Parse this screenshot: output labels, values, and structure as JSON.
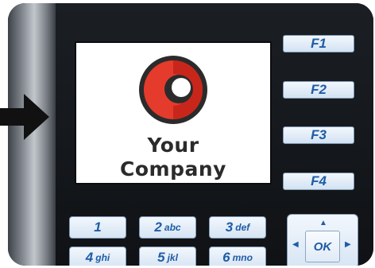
{
  "screen": {
    "company_line1": "Your",
    "company_line2": "Company"
  },
  "function_keys": [
    "F1",
    "F2",
    "F3",
    "F4"
  ],
  "keypad": [
    {
      "digit": "1",
      "letters": ""
    },
    {
      "digit": "2",
      "letters": "abc"
    },
    {
      "digit": "3",
      "letters": "def"
    },
    {
      "digit": "4",
      "letters": "ghi"
    },
    {
      "digit": "5",
      "letters": "jkl"
    },
    {
      "digit": "6",
      "letters": "mno"
    }
  ],
  "nav": {
    "ok_label": "OK"
  },
  "colors": {
    "logo_red": "#e53b2c",
    "logo_dark": "#2b2b2b",
    "key_text": "#1f5ca6",
    "device_body": "#14171b"
  },
  "icons": {
    "pointer": "arrow-right-icon",
    "logo": "company-logo-icon",
    "nav_up": "chevron-up-icon",
    "nav_left": "chevron-left-icon",
    "nav_right": "chevron-right-icon"
  }
}
